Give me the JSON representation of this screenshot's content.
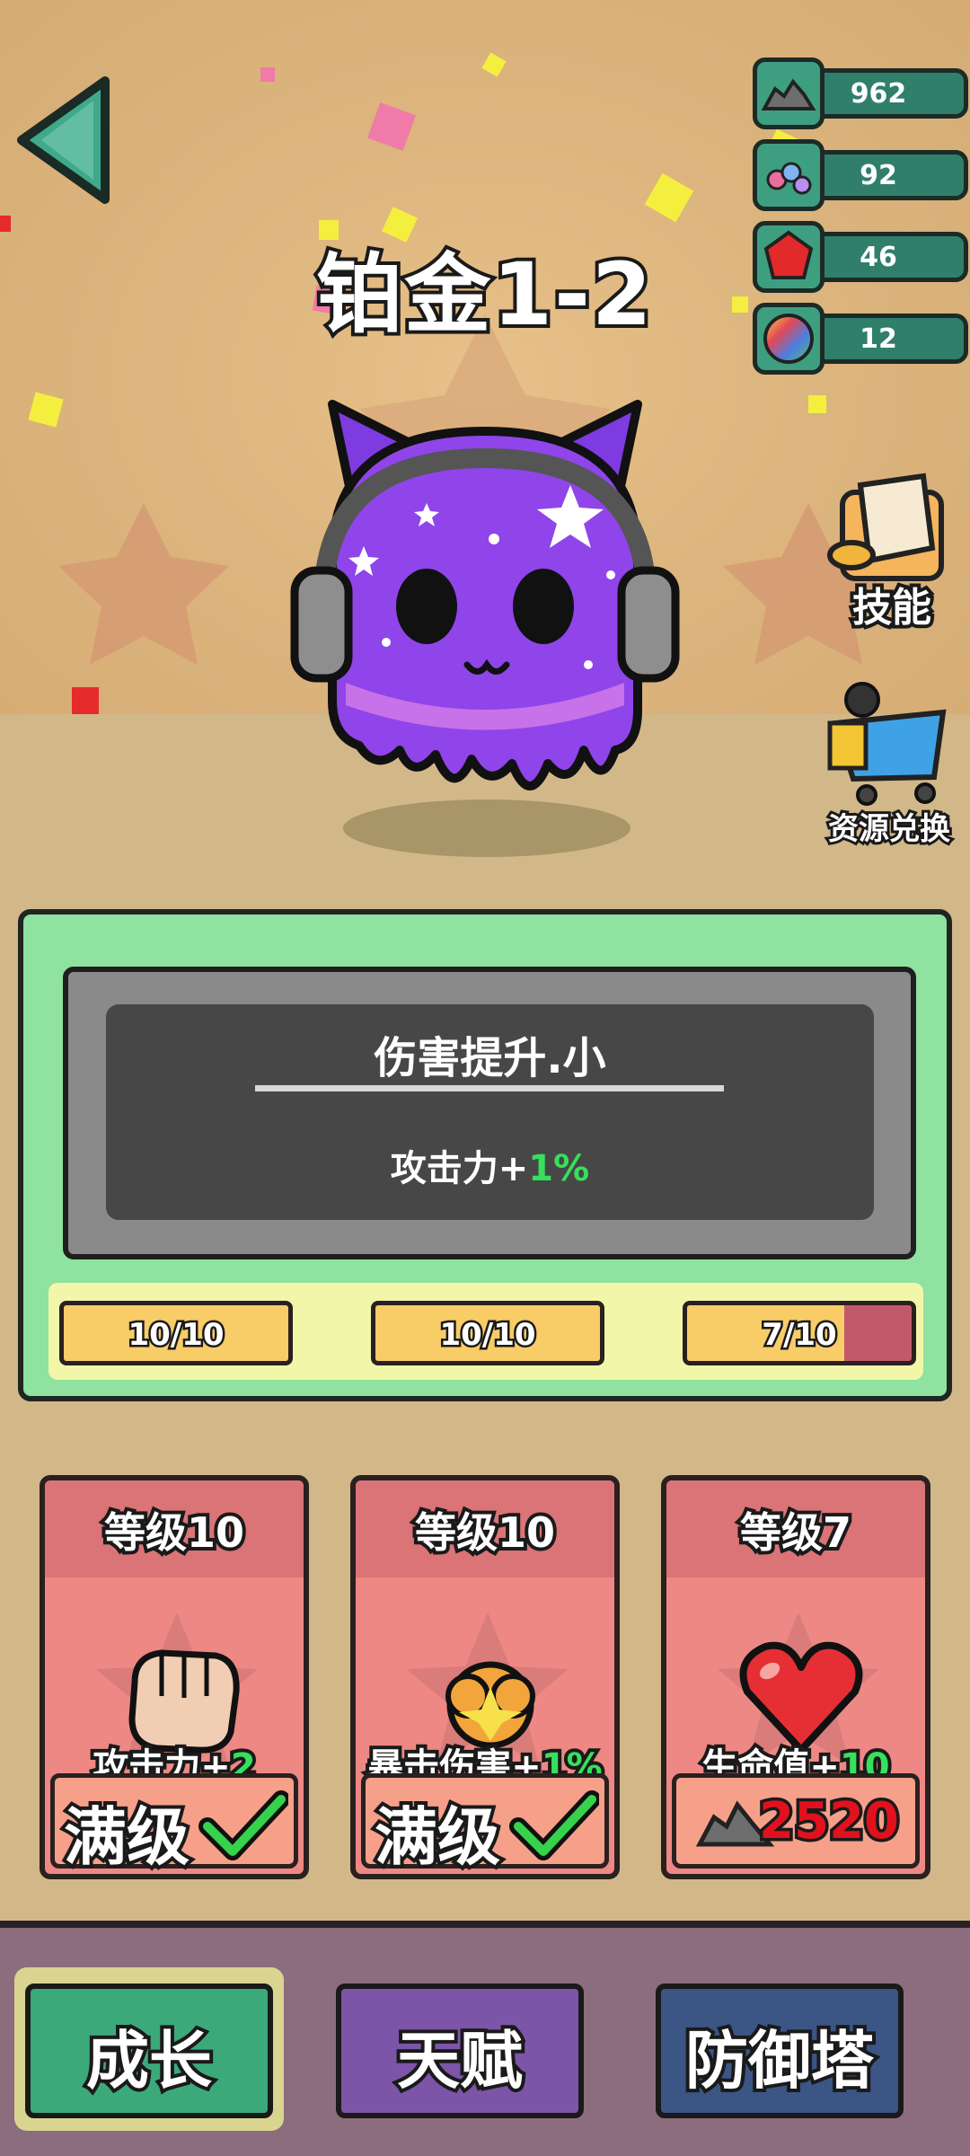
{
  "level_title": "铂金1-2",
  "resources": [
    {
      "icon": "ore-pile-icon",
      "value": "962"
    },
    {
      "icon": "candy-icon",
      "value": "92"
    },
    {
      "icon": "red-gem-icon",
      "value": "46"
    },
    {
      "icon": "rainbow-orb-icon",
      "value": "12"
    }
  ],
  "side_buttons": {
    "skills_label": "技能",
    "exchange_label": "资源兑换"
  },
  "info_panel": {
    "title": "伤害提升.小",
    "desc_prefix": "攻击力+",
    "desc_value": "1%"
  },
  "progress": [
    {
      "label": "10/10",
      "fraction": 1.0
    },
    {
      "label": "10/10",
      "fraction": 1.0
    },
    {
      "label": "7/10",
      "fraction": 0.7
    }
  ],
  "cards": [
    {
      "level": "等级10",
      "stat_prefix": "攻击力+",
      "stat_value": "2",
      "status": "满级",
      "icon": "fist-icon"
    },
    {
      "level": "等级10",
      "stat_prefix": "暴击伤害+",
      "stat_value": "1%",
      "status": "满级",
      "icon": "explosion-icon"
    },
    {
      "level": "等级7",
      "stat_prefix": "生命值+",
      "stat_value": "10",
      "cost": "2520",
      "icon": "heart-icon"
    }
  ],
  "nav": {
    "growth": "成长",
    "talent": "天赋",
    "tower": "防御塔"
  },
  "colors": {
    "resource_bar": "#2f7f6b",
    "panel_green": "#8fe2a0",
    "card_red": "#ee8884",
    "highlight_green": "#37e05a",
    "nav_growth": "#3ba97a",
    "nav_talent": "#7d55a8",
    "nav_tower": "#3b5585"
  }
}
